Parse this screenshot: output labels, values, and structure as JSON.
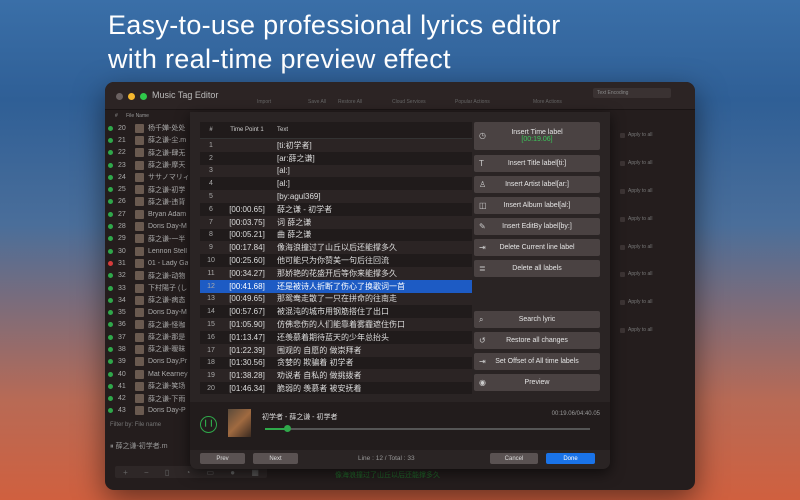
{
  "headline": [
    "Easy-to-use professional lyrics editor",
    "with real-time preview effect"
  ],
  "window": {
    "title": "Music Tag Editor",
    "toolbar": [
      "Import",
      "Save All",
      "Restore All",
      "Cloud Services",
      "Popular Actions",
      "More Actions",
      "Text Encoding"
    ],
    "encoding_select": "Text Encoding"
  },
  "file_list": {
    "headers": [
      "#",
      "File Name"
    ],
    "rows": [
      {
        "n": "20",
        "name": "杨千嬅-处处"
      },
      {
        "n": "21",
        "name": "薛之谦-尘.m"
      },
      {
        "n": "22",
        "name": "薛之谦-肆无"
      },
      {
        "n": "23",
        "name": "薛之谦-摩天"
      },
      {
        "n": "24",
        "name": "ササノマリィ"
      },
      {
        "n": "25",
        "name": "薛之谦-初学"
      },
      {
        "n": "26",
        "name": "薛之谦-违背"
      },
      {
        "n": "27",
        "name": "Bryan Adam"
      },
      {
        "n": "28",
        "name": "Doris Day-M"
      },
      {
        "n": "29",
        "name": "薛之谦-一半"
      },
      {
        "n": "30",
        "name": "Lennon Stell"
      },
      {
        "n": "31",
        "name": "01 - Lady Ga",
        "status": "error"
      },
      {
        "n": "32",
        "name": "薛之谦-动物"
      },
      {
        "n": "33",
        "name": "下村陽子 (し"
      },
      {
        "n": "34",
        "name": "薛之谦-病态"
      },
      {
        "n": "35",
        "name": "Doris Day-M"
      },
      {
        "n": "36",
        "name": "薛之谦-怪咖"
      },
      {
        "n": "37",
        "name": "薛之谦-那是"
      },
      {
        "n": "38",
        "name": "薛之谦-暧昧"
      },
      {
        "n": "39",
        "name": "Doris Day,Pr"
      },
      {
        "n": "40",
        "name": "Mat Kearney"
      },
      {
        "n": "41",
        "name": "薛之谦-笑场"
      },
      {
        "n": "42",
        "name": "薛之谦-下雨"
      },
      {
        "n": "43",
        "name": "Doris Day-P"
      }
    ],
    "filter_label": "Filter by:",
    "filter_value": "File name",
    "now_playing": "薛之谦-初学者.m"
  },
  "apply_label": "Apply to all",
  "status_lyric": "像海浪撞过了山丘以后还能撑多久",
  "lyrics": {
    "headers": [
      "#",
      "Time Point 1",
      "Text"
    ],
    "rows": [
      {
        "n": "1",
        "t": "",
        "text": "[ti:初学者]"
      },
      {
        "n": "2",
        "t": "",
        "text": "[ar:薛之谦]"
      },
      {
        "n": "3",
        "t": "",
        "text": "[al:]"
      },
      {
        "n": "4",
        "t": "",
        "text": "[al:]"
      },
      {
        "n": "5",
        "t": "",
        "text": "[by:agul369]"
      },
      {
        "n": "6",
        "t": "[00:00.65]",
        "text": "薛之谦 - 初学者"
      },
      {
        "n": "7",
        "t": "[00:03.75]",
        "text": "词 薛之谦"
      },
      {
        "n": "8",
        "t": "[00:05.21]",
        "text": "曲 薛之谦"
      },
      {
        "n": "9",
        "t": "[00:17.84]",
        "text": "像海浪撞过了山丘以后还能撑多久"
      },
      {
        "n": "10",
        "t": "[00:25.60]",
        "text": "他可能只为你赞美一句后往回流"
      },
      {
        "n": "11",
        "t": "[00:34.27]",
        "text": "那娇艳的花盛开后等你来能撑多久"
      },
      {
        "n": "12",
        "t": "[00:41.68]",
        "text": "还是被诗人折断了伤心了换歌词一首",
        "selected": true
      },
      {
        "n": "13",
        "t": "[00:49.65]",
        "text": "那鸳鸯走散了一只在拼命的往南走"
      },
      {
        "n": "14",
        "t": "[00:57.67]",
        "text": "被混沌的城市用钢筋搭住了出口"
      },
      {
        "n": "15",
        "t": "[01:05.90]",
        "text": "仿佛悲伤的人们能靠着雾霾遮住伤口"
      },
      {
        "n": "16",
        "t": "[01:13.47]",
        "text": "还羡慕着期待蓝天的少年总抬头"
      },
      {
        "n": "17",
        "t": "[01:22.39]",
        "text": "围观的 自愿的 做崇拜者"
      },
      {
        "n": "18",
        "t": "[01:30.56]",
        "text": "贪婪的 欺骗着 初学者"
      },
      {
        "n": "19",
        "t": "[01:38.28]",
        "text": "劝说者 自私的 做挑拨者"
      },
      {
        "n": "20",
        "t": "[01:46.34]",
        "text": "脆弱的 羡慕者 被安抚着"
      }
    ]
  },
  "actions": {
    "insert_time": "Insert Time label",
    "current_time": "[00:19.06]",
    "insert_title": "Insert Title label[ti:]",
    "insert_artist": "Insert Artist label[ar:]",
    "insert_album": "Insert Album label[al:]",
    "insert_editby": "Insert EditBy label[by:]",
    "delete_current": "Delete Current line label",
    "delete_all": "Delete all labels",
    "search": "Search lyric",
    "restore": "Restore all changes",
    "offset": "Set Offset of All time labels",
    "preview": "Preview"
  },
  "player": {
    "song": "初学者 - 薛之谦 - 初学者",
    "time": "00:19.06/04:40.05",
    "progress": 0.068
  },
  "footer": {
    "prev": "Prev",
    "next": "Next",
    "line_info": "Line : 12 / Total : 33",
    "cancel": "Cancel",
    "done": "Done"
  },
  "colors": {
    "accent": "#1d5bc4",
    "green": "#2fa84a",
    "done": "#1a73e8"
  }
}
